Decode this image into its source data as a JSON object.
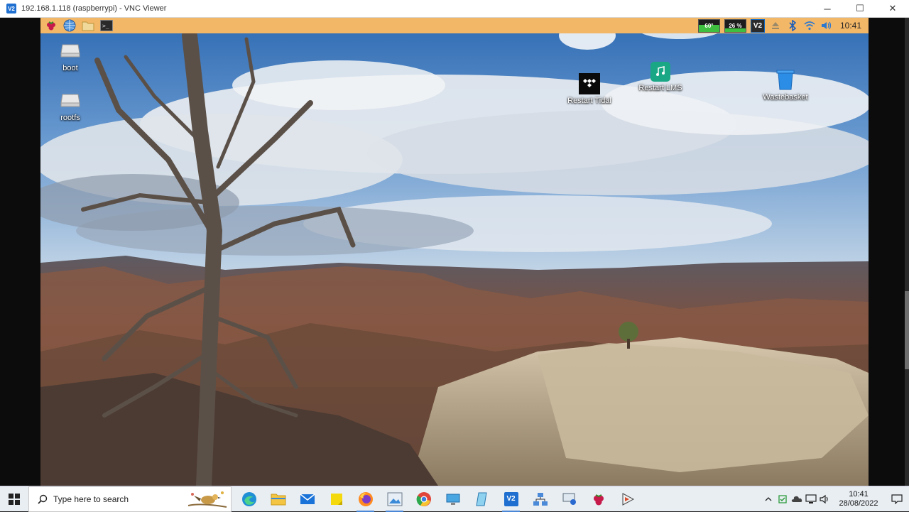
{
  "window": {
    "logo_text": "V2",
    "title": "192.168.1.118 (raspberrypi) - VNC Viewer",
    "minimize_glyph": "─",
    "maximize_glyph": "☐",
    "close_glyph": "✕"
  },
  "pi_panel": {
    "launcher": [
      "raspberry-menu-icon",
      "web-browser-icon",
      "file-manager-icon",
      "terminal-icon"
    ],
    "terminal_glyph": ">_",
    "temp_label": "60°",
    "cpu_label": "26 %",
    "cpu_fraction": 0.26,
    "vnc_label": "V2",
    "time": "10:41"
  },
  "desktop_icons": [
    {
      "name": "boot",
      "label": "boot"
    },
    {
      "name": "rootfs",
      "label": "rootfs"
    },
    {
      "name": "restart-tidal",
      "label": "Restart Tidal"
    },
    {
      "name": "restart-lms",
      "label": "Restart LMS"
    },
    {
      "name": "wastebasket",
      "label": "Wastebasket"
    }
  ],
  "taskbar": {
    "search_placeholder": "Type here to search",
    "apps": [
      "edge-icon",
      "file-explorer-icon",
      "mail-icon",
      "sticky-notes-icon",
      "firefox-icon",
      "photos-icon",
      "chrome-icon",
      "remote-desktop-icon",
      "notepad-icon",
      "vnc-viewer-icon",
      "network-icon",
      "pc-settings-icon",
      "raspberry-imager-icon",
      "media-player-icon"
    ],
    "time": "10:41",
    "date": "28/08/2022"
  }
}
